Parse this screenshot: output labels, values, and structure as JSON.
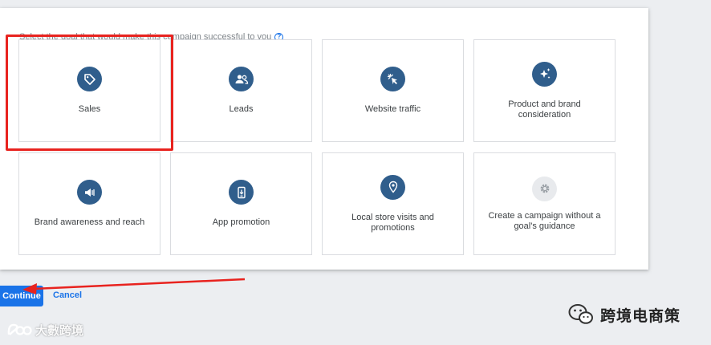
{
  "instruction": {
    "text": "Select the goal that would make this campaign successful to you",
    "help_icon": "question-circle-icon"
  },
  "goals": [
    {
      "label": "Sales",
      "icon": "tag-icon",
      "selected": true
    },
    {
      "label": "Leads",
      "icon": "people-icon"
    },
    {
      "label": "Website traffic",
      "icon": "cursor-click-icon"
    },
    {
      "label": "Product and brand consideration",
      "icon": "sparkle-icon"
    },
    {
      "label": "Brand awareness and reach",
      "icon": "megaphone-icon"
    },
    {
      "label": "App promotion",
      "icon": "phone-download-icon"
    },
    {
      "label": "Local store visits and promotions",
      "icon": "location-pin-icon"
    },
    {
      "label": "Create a campaign without a goal's guidance",
      "icon": "gear-icon"
    }
  ],
  "actions": {
    "continue_label": "Continue",
    "cancel_label": "Cancel"
  },
  "watermarks": {
    "right_text": "跨境电商策",
    "left_text": "大數跨境"
  },
  "colors": {
    "accent": "#1a73e8",
    "icon_bg": "#305e8c",
    "highlight": "#e8231f"
  }
}
